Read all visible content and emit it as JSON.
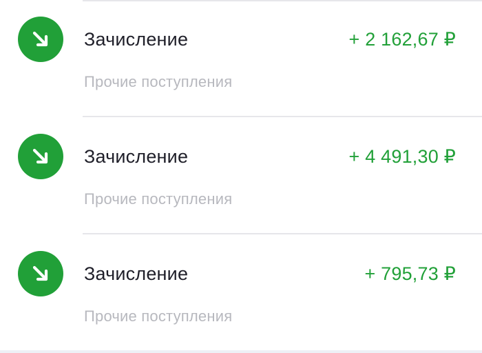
{
  "colors": {
    "income_green": "#21a038",
    "title_dark": "#1f1f29",
    "subtitle_gray": "#b7b8be"
  },
  "transactions": [
    {
      "icon": "arrow-down-right-icon",
      "title": "Зачисление",
      "amount": "+ 2 162,67 ₽",
      "category": "Прочие поступления"
    },
    {
      "icon": "arrow-down-right-icon",
      "title": "Зачисление",
      "amount": "+ 4 491,30 ₽",
      "category": "Прочие поступления"
    },
    {
      "icon": "arrow-down-right-icon",
      "title": "Зачисление",
      "amount": "+ 795,73 ₽",
      "category": "Прочие поступления"
    }
  ]
}
